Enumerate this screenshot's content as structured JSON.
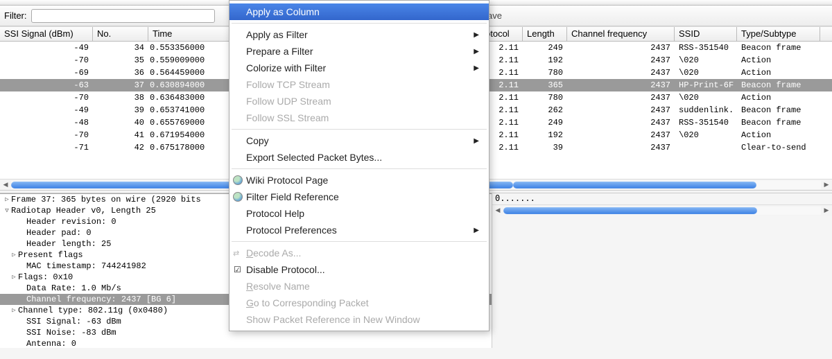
{
  "filter": {
    "label": "Filter:",
    "value": "",
    "save": "Save"
  },
  "columns": {
    "ssi": "SSI Signal (dBm)",
    "no": "No.",
    "time": "Time",
    "protocol": "otocol",
    "length": "Length",
    "chanfreq": "Channel frequency",
    "ssid": "SSID",
    "typesub": "Type/Subtype"
  },
  "packets": [
    {
      "ssi": "-49",
      "no": "34",
      "time": "0.553356000",
      "proto": "2.11",
      "len": "249",
      "cf": "2437",
      "ssid": "RSS-351540",
      "ts": "Beacon frame"
    },
    {
      "ssi": "-70",
      "no": "35",
      "time": "0.559009000",
      "proto": "2.11",
      "len": "192",
      "cf": "2437",
      "ssid": "\\020",
      "ts": "Action"
    },
    {
      "ssi": "-69",
      "no": "36",
      "time": "0.564459000",
      "proto": "2.11",
      "len": "780",
      "cf": "2437",
      "ssid": "\\020",
      "ts": "Action"
    },
    {
      "ssi": "-63",
      "no": "37",
      "time": "0.630894000",
      "proto": "2.11",
      "len": "365",
      "cf": "2437",
      "ssid": "HP-Print-6F",
      "ts": "Beacon frame",
      "selected": true
    },
    {
      "ssi": "-70",
      "no": "38",
      "time": "0.636483000",
      "proto": "2.11",
      "len": "780",
      "cf": "2437",
      "ssid": "\\020",
      "ts": "Action"
    },
    {
      "ssi": "-49",
      "no": "39",
      "time": "0.653741000",
      "proto": "2.11",
      "len": "262",
      "cf": "2437",
      "ssid": "suddenlink.",
      "ts": "Beacon frame"
    },
    {
      "ssi": "-48",
      "no": "40",
      "time": "0.655769000",
      "proto": "2.11",
      "len": "249",
      "cf": "2437",
      "ssid": "RSS-351540",
      "ts": "Beacon frame"
    },
    {
      "ssi": "-70",
      "no": "41",
      "time": "0.671954000",
      "proto": "2.11",
      "len": "192",
      "cf": "2437",
      "ssid": "\\020",
      "ts": "Action"
    },
    {
      "ssi": "-71",
      "no": "42",
      "time": "0.675178000",
      "proto": "2.11",
      "len": "39",
      "cf": "2437",
      "ssid": "",
      "ts": "Clear-to-send"
    }
  ],
  "tree": [
    {
      "exp": "▷",
      "indent": 0,
      "text": "Frame 37: 365 bytes on wire (2920 bits"
    },
    {
      "exp": "▽",
      "indent": 0,
      "text": "Radiotap Header v0, Length 25"
    },
    {
      "indent": 2,
      "text": "Header revision: 0"
    },
    {
      "indent": 2,
      "text": "Header pad: 0"
    },
    {
      "indent": 2,
      "text": "Header length: 25"
    },
    {
      "exp": "▷",
      "indent": 1,
      "text": "Present flags"
    },
    {
      "indent": 2,
      "text": "MAC timestamp: 744241982"
    },
    {
      "exp": "▷",
      "indent": 1,
      "text": "Flags: 0x10"
    },
    {
      "indent": 2,
      "text": "Data Rate: 1.0 Mb/s"
    },
    {
      "indent": 2,
      "text": "Channel frequency: 2437 [BG 6]",
      "selected": true
    },
    {
      "exp": "▷",
      "indent": 1,
      "text": "Channel type: 802.11g (0x0480)"
    },
    {
      "indent": 2,
      "text": "SSI Signal: -63 dBm"
    },
    {
      "indent": 2,
      "text": "SSI Noise: -83 dBm"
    },
    {
      "indent": 2,
      "text": "Antenna: 0"
    }
  ],
  "bytes_row": "0.......",
  "menu": {
    "apply_col": "Apply as Column",
    "apply_filter": "Apply as Filter",
    "prepare_filter": "Prepare a Filter",
    "colorize": "Colorize with Filter",
    "follow_tcp": "Follow TCP Stream",
    "follow_udp": "Follow UDP Stream",
    "follow_ssl": "Follow SSL Stream",
    "copy": "Copy",
    "export_bytes": "Export Selected Packet Bytes...",
    "wiki": "Wiki Protocol Page",
    "field_ref": "Filter Field Reference",
    "proto_help": "Protocol Help",
    "proto_prefs": "Protocol Preferences",
    "decode_as": "Decode As...",
    "disable_proto": "Disable Protocol...",
    "resolve_name": "Resolve Name",
    "goto_corr": "Go to Corresponding Packet",
    "show_ref": "Show Packet Reference in New Window"
  }
}
